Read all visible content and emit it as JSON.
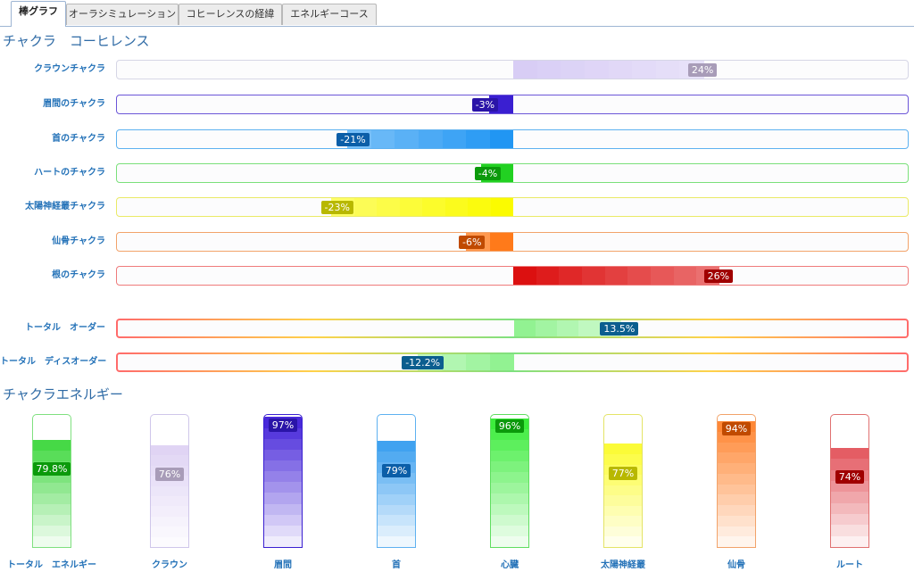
{
  "tabs": [
    {
      "label": "棒グラフ",
      "active": true
    },
    {
      "label": "オーラシミュレーション",
      "active": false
    },
    {
      "label": "コヒーレンスの経緯",
      "active": false
    },
    {
      "label": "エネルギーコース",
      "active": false
    }
  ],
  "coherence": {
    "title": "チャクラ　コーヒレンス",
    "rows": [
      {
        "label": "クラウンチャクラ",
        "value": 24,
        "display": "24%",
        "color": "#d8cdf5",
        "badge": "#a89cb8",
        "border": "#d6d6e6"
      },
      {
        "label": "眉間のチャクラ",
        "value": -3,
        "display": "-3%",
        "color": "#3a1fd1",
        "badge": "#2a14a8",
        "border": "#6b55d8"
      },
      {
        "label": "首のチャクラ",
        "value": -21,
        "display": "-21%",
        "color": "#2196f3",
        "badge": "#0b5ea8",
        "border": "#5eb1f0"
      },
      {
        "label": "ハートのチャクラ",
        "value": -4,
        "display": "-4%",
        "color": "#22d122",
        "badge": "#0b9a0b",
        "border": "#7be07b"
      },
      {
        "label": "太陽神経叢チャクラ",
        "value": -23,
        "display": "-23%",
        "color": "#fbfb00",
        "badge": "#b8b800",
        "border": "#eaea66"
      },
      {
        "label": "仙骨チャクラ",
        "value": -6,
        "display": "-6%",
        "color": "#ff7a1a",
        "badge": "#c04a00",
        "border": "#f2a36a"
      },
      {
        "label": "根のチャクラ",
        "value": 26,
        "display": "26%",
        "color": "#dc1010",
        "badge": "#a00000",
        "border": "#ef7b7b"
      }
    ],
    "totals": [
      {
        "label": "トータル　オーダー",
        "value": 13.5,
        "display": "13.5%",
        "color": "#7ff07f",
        "badge": "#0b5e8f"
      },
      {
        "label": "トータル　ディスオーダー",
        "value": -12.2,
        "display": "-12.2%",
        "color": "#7ff07f",
        "badge": "#0b5e8f"
      }
    ]
  },
  "energy": {
    "title": "チャクラエネルギー",
    "columns": [
      {
        "label": "トータル　エネルギー",
        "value": 79.8,
        "display": "79.8%",
        "color": "#2fd42f",
        "badge": "#0b9a0b",
        "border": "#7fe07f"
      },
      {
        "label": "クラウン",
        "value": 76,
        "display": "76%",
        "color": "#dccff3",
        "badge": "#a89cb8",
        "border": "#cfc6ea"
      },
      {
        "label": "眉間",
        "value": 97,
        "display": "97%",
        "color": "#3512d6",
        "badge": "#2a14a8",
        "border": "#3a1fd1"
      },
      {
        "label": "首",
        "value": 79,
        "display": "79%",
        "color": "#2896ee",
        "badge": "#0b5ea8",
        "border": "#5eb1f0"
      },
      {
        "label": "心臓",
        "value": 96,
        "display": "96%",
        "color": "#28ea28",
        "badge": "#0b9a0b",
        "border": "#5fde5f"
      },
      {
        "label": "太陽神経叢",
        "value": 77,
        "display": "77%",
        "color": "#fbfb1f",
        "badge": "#b8b800",
        "border": "#e4e466"
      },
      {
        "label": "仙骨",
        "value": 94,
        "display": "94%",
        "color": "#ff7c22",
        "badge": "#c04a00",
        "border": "#f2a36a"
      },
      {
        "label": "ルート",
        "value": 74,
        "display": "74%",
        "color": "#e0474f",
        "badge": "#a00000",
        "border": "#e07070"
      }
    ]
  }
}
